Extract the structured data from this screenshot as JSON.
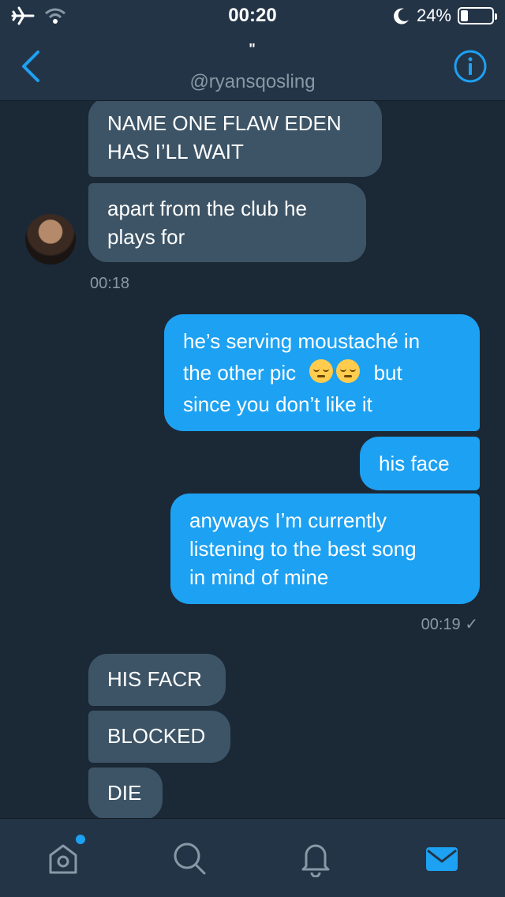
{
  "status_bar": {
    "time": "00:20",
    "battery_text": "24%",
    "battery_level": 0.24
  },
  "header": {
    "name": "\"",
    "handle": "@ryansqosling"
  },
  "messages": [
    {
      "direction": "received",
      "lines": [
        "NAME ONE FLAW EDEN",
        "HAS I’LL WAIT"
      ]
    },
    {
      "direction": "received",
      "lines": [
        "apart from the club he",
        "plays for"
      ]
    },
    {
      "direction": "sent",
      "lines": [
        "he’s serving moustaché in",
        "the other pic",
        "but",
        "since you don’t like it"
      ]
    },
    {
      "direction": "sent",
      "lines": [
        "his face"
      ]
    },
    {
      "direction": "sent",
      "lines": [
        "anyways I’m currently",
        "listening to the best song",
        "in mind of mine"
      ]
    },
    {
      "direction": "received",
      "lines": [
        "HIS FACR"
      ]
    },
    {
      "direction": "received",
      "lines": [
        "BLOCKED"
      ]
    },
    {
      "direction": "received",
      "lines": [
        "DIE"
      ]
    }
  ],
  "timestamps": {
    "received_group": "00:18",
    "sent_group": "00:19 ✓"
  },
  "icons": {
    "back": "chevron-left-icon",
    "info": "info-icon",
    "home": "home-icon",
    "search": "search-icon",
    "notifications": "bell-icon",
    "messages": "mail-icon"
  },
  "colors": {
    "background": "#1b2836",
    "header": "#243447",
    "accent": "#1da1f2",
    "received_bubble": "#3d5466",
    "secondary_text": "#8899a6"
  }
}
